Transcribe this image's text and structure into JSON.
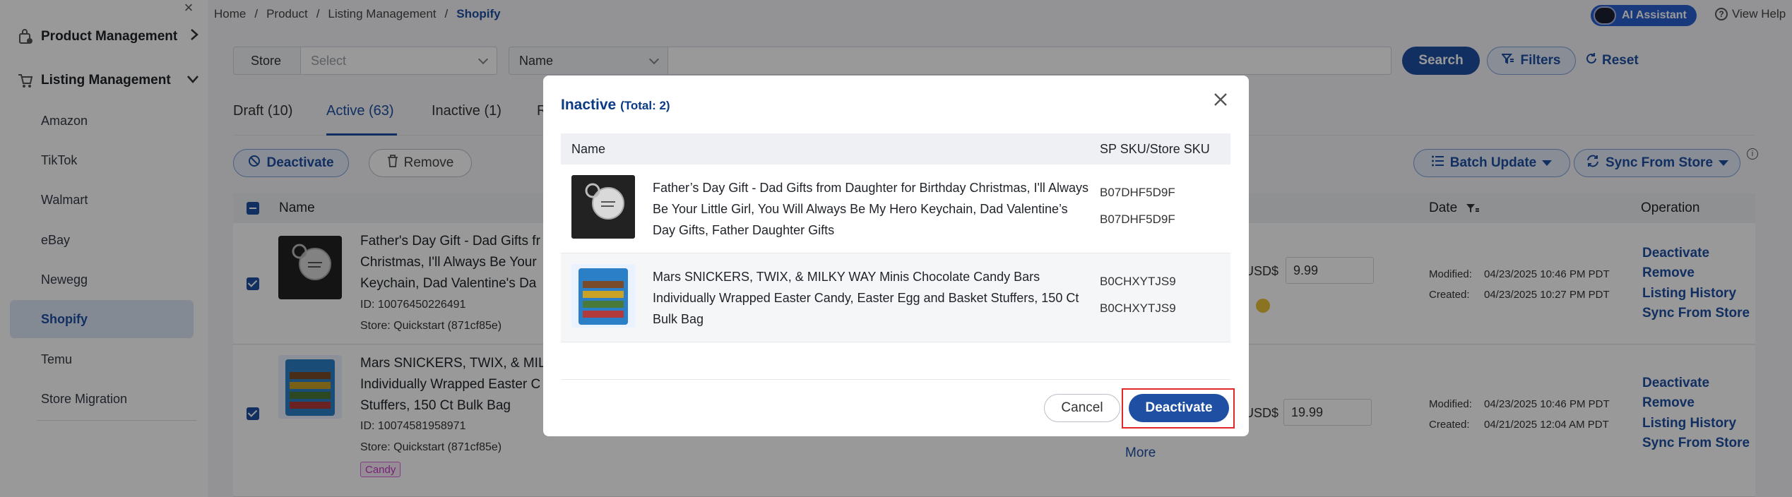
{
  "sidebar": {
    "groups": [
      {
        "label": "Product Management",
        "icon": "bag-lock-icon"
      },
      {
        "label": "Listing Management",
        "icon": "cart-icon"
      }
    ],
    "items": [
      {
        "label": "Amazon"
      },
      {
        "label": "TikTok"
      },
      {
        "label": "Walmart"
      },
      {
        "label": "eBay"
      },
      {
        "label": "Newegg"
      },
      {
        "label": "Shopify"
      },
      {
        "label": "Temu"
      },
      {
        "label": "Store Migration"
      }
    ],
    "active_item": "Shopify"
  },
  "breadcrumb": [
    "Home",
    "Product",
    "Listing Management",
    "Shopify"
  ],
  "header": {
    "ai_assistant": "AI Assistant",
    "view_help": "View Help"
  },
  "filters": {
    "store_label": "Store",
    "store_placeholder": "Select",
    "name_field": "Name",
    "search": "Search",
    "filters": "Filters",
    "reset": "Reset"
  },
  "tabs": [
    {
      "label": "Draft (10)"
    },
    {
      "label": "Active (63)"
    },
    {
      "label": "Inactive (1)"
    },
    {
      "label": "R"
    }
  ],
  "actions": {
    "deactivate": "Deactivate",
    "remove": "Remove",
    "batch_update": "Batch Update",
    "sync_from_store": "Sync From Store"
  },
  "table": {
    "headers": {
      "name": "Name",
      "date": "Date",
      "operation": "Operation"
    },
    "rows": [
      {
        "title": "Father's Day Gift - Dad Gifts fr\nChristmas, I'll Always Be Your\nKeychain, Dad Valentine's Da",
        "id": "ID: 10076450226491",
        "store": "Store: Quickstart (871cf85e)",
        "currency": "USD$",
        "price": "9.99",
        "modified_label": "Modified:",
        "modified": "04/23/2025 10:46 PM PDT",
        "created_label": "Created:",
        "created": "04/23/2025 10:27 PM PDT"
      },
      {
        "title": "Mars SNICKERS, TWIX, & MILKY\nIndividually Wrapped Easter C\nStuffers, 150 Ct Bulk Bag",
        "id": "ID: 10074581958971",
        "store": "Store: Quickstart (871cf85e)",
        "tag": "Candy",
        "currency": "USD$",
        "price": "19.99",
        "modified_label": "Modified:",
        "modified": "04/23/2025 10:46 PM PDT",
        "created_label": "Created:",
        "created": "04/21/2025 12:04 AM PDT",
        "more": "More"
      }
    ],
    "operations": [
      "Deactivate",
      "Remove",
      "Listing History",
      "Sync From Store"
    ]
  },
  "modal": {
    "title": "Inactive",
    "total": "(Total: 2)",
    "col_name": "Name",
    "col_sku": "SP SKU/Store SKU",
    "items": [
      {
        "name": "Father’s Day Gift - Dad Gifts from Daughter for Birthday Christmas, I'll Always Be Your Little Girl, You Will Always Be My Hero Keychain, Dad Valentine’s Day Gifts, Father Daughter Gifts",
        "sp_sku": "B07DHF5D9F",
        "store_sku": "B07DHF5D9F"
      },
      {
        "name": "Mars SNICKERS, TWIX, & MILKY WAY Minis Chocolate Candy Bars Individually Wrapped Easter Candy, Easter Egg and Basket Stuffers, 150 Ct Bulk Bag",
        "sp_sku": "B0CHXYTJS9",
        "store_sku": "B0CHXYTJS9"
      }
    ],
    "cancel": "Cancel",
    "confirm": "Deactivate"
  },
  "colors": {
    "primary": "#1e4fa3",
    "highlight": "#e02828",
    "tag": "#c33ac0"
  }
}
